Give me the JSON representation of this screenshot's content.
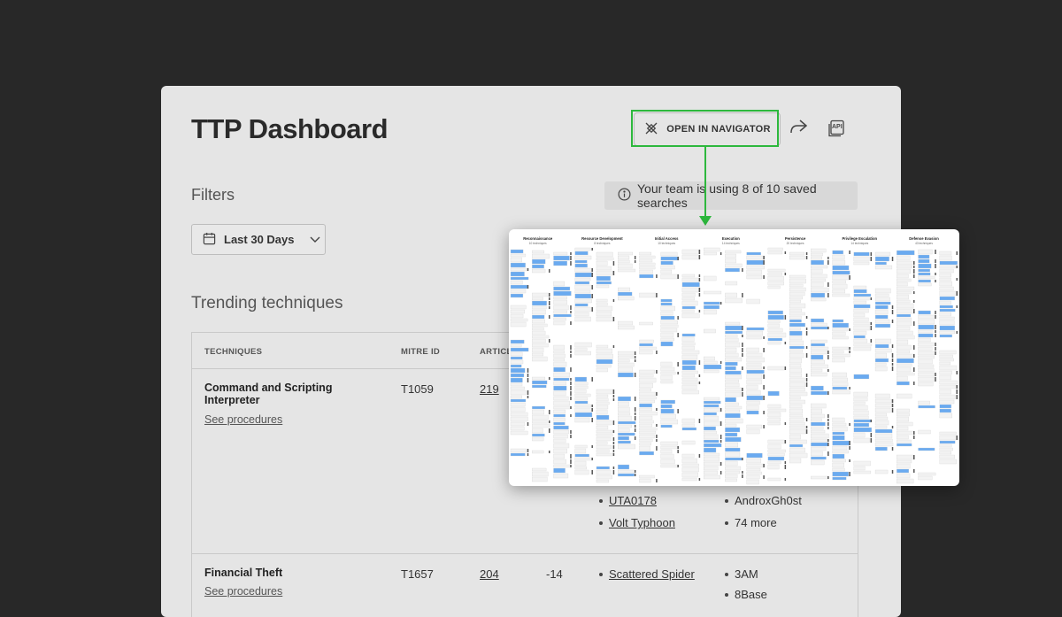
{
  "page": {
    "title": "TTP Dashboard"
  },
  "toolbar": {
    "open_navigator_label": "OPEN IN NAVIGATOR",
    "share_icon": "share-icon",
    "api_icon": "api-icon",
    "api_label": "API"
  },
  "filters": {
    "heading": "Filters",
    "date_range_label": "Last 30 Days",
    "notice_text": "Your team is using 8 of 10 saved searches"
  },
  "trending": {
    "heading": "Trending techniques",
    "columns": [
      "TECHNIQUES",
      "MITRE ID",
      "ARTICL"
    ],
    "rows": [
      {
        "name": "Command and Scripting Interpreter",
        "link": "See procedures",
        "mitre_id": "T1059",
        "articles": "219",
        "change": "",
        "actors_a": [
          "UTA0178",
          "Volt Typhoon"
        ],
        "actors_b": [
          "AndroxGh0st",
          "74 more"
        ]
      },
      {
        "name": "Financial Theft",
        "link": "See procedures",
        "mitre_id": "T1657",
        "articles": "204",
        "change": "-14",
        "actors_a": [
          "Scattered Spider"
        ],
        "actors_b": [
          "3AM",
          "8Base"
        ]
      }
    ]
  },
  "navigator": {
    "tactics": [
      {
        "name": "Reconnaissance",
        "count": "10 techniques"
      },
      {
        "name": "Resource Development",
        "count": "8 techniques"
      },
      {
        "name": "Initial Access",
        "count": "10 techniques"
      },
      {
        "name": "Execution",
        "count": "14 techniques"
      },
      {
        "name": "Persistence",
        "count": "20 techniques"
      },
      {
        "name": "Privilege Escalation",
        "count": "14 techniques"
      },
      {
        "name": "Defense Evasion",
        "count": "43 techniques"
      }
    ]
  },
  "colors": {
    "background": "#282828",
    "panel": "#e5e5e5",
    "highlight": "#2db83d",
    "nav_blue": "#6aaaf0"
  }
}
